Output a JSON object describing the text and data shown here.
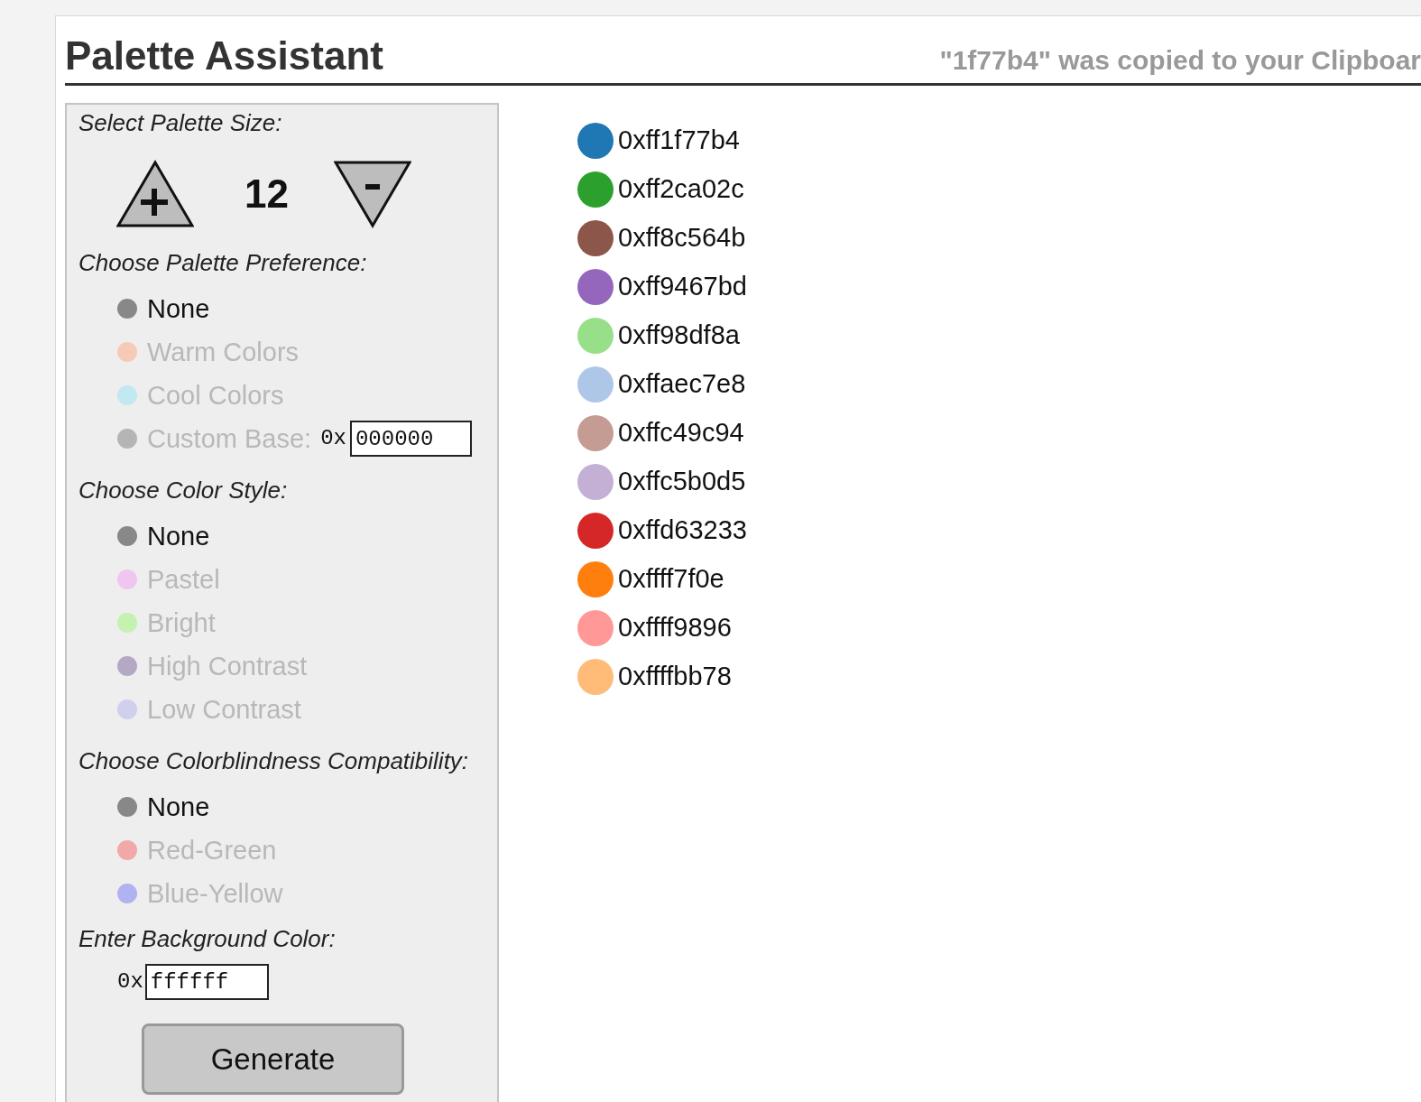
{
  "title": "Palette Assistant",
  "notice": "\"1f77b4\" was copied to your Clipboar",
  "size_section": {
    "label": "Select Palette Size:",
    "count": "12"
  },
  "sections": [
    {
      "label": "Choose Palette Preference:",
      "options": [
        {
          "label": "None",
          "color": "#888888",
          "selected": true
        },
        {
          "label": "Warm Colors",
          "color": "#f5cbb5",
          "selected": false
        },
        {
          "label": "Cool Colors",
          "color": "#c2e8f2",
          "selected": false
        },
        {
          "label": "Custom Base:",
          "color": "#b5b5b5",
          "selected": false,
          "kind": "field",
          "prefix": "0x",
          "value": "000000"
        }
      ]
    },
    {
      "label": "Choose Color Style:",
      "options": [
        {
          "label": "None",
          "color": "#888888",
          "selected": true
        },
        {
          "label": "Pastel",
          "color": "#f0c6f0",
          "selected": false
        },
        {
          "label": "Bright",
          "color": "#c4f2b0",
          "selected": false
        },
        {
          "label": "High Contrast",
          "color": "#b4a8c4",
          "selected": false
        },
        {
          "label": "Low Contrast",
          "color": "#cfd0ee",
          "selected": false
        }
      ]
    },
    {
      "label": "Choose Colorblindness Compatibility:",
      "options": [
        {
          "label": "None",
          "color": "#888888",
          "selected": true
        },
        {
          "label": "Red-Green",
          "color": "#f2a8a8",
          "selected": false
        },
        {
          "label": "Blue-Yellow",
          "color": "#b0b2f2",
          "selected": false
        }
      ]
    }
  ],
  "background": {
    "label": "Enter Background Color:",
    "prefix": "0x",
    "value": "ffffff"
  },
  "generate_button": "Generate",
  "swatches": [
    {
      "label": "0xff1f77b4",
      "color": "#1f77b4"
    },
    {
      "label": "0xff2ca02c",
      "color": "#2ca02c"
    },
    {
      "label": "0xff8c564b",
      "color": "#8c564b"
    },
    {
      "label": "0xff9467bd",
      "color": "#9467bd"
    },
    {
      "label": "0xff98df8a",
      "color": "#98df8a"
    },
    {
      "label": "0xffaec7e8",
      "color": "#aec7e8"
    },
    {
      "label": "0xffc49c94",
      "color": "#c49c94"
    },
    {
      "label": "0xffc5b0d5",
      "color": "#c5b0d5"
    },
    {
      "label": "0xffd63233",
      "color": "#d62728"
    },
    {
      "label": "0xffff7f0e",
      "color": "#ff7f0e"
    },
    {
      "label": "0xffff9896",
      "color": "#ff9896"
    },
    {
      "label": "0xffffbb78",
      "color": "#ffbb78"
    }
  ]
}
